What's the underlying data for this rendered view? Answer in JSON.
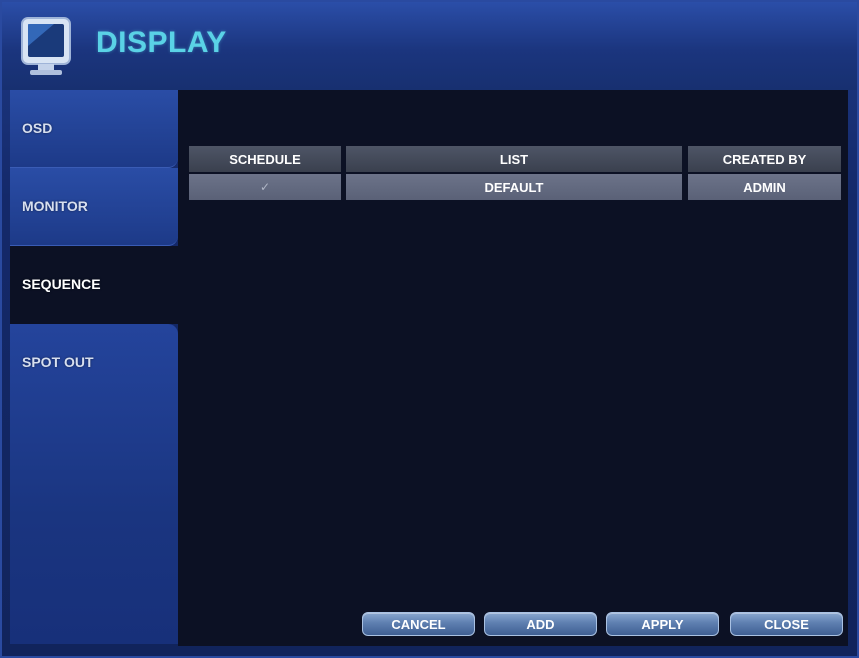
{
  "header": {
    "title": "DISPLAY",
    "icon": "monitor-icon"
  },
  "sidebar": {
    "items": [
      {
        "label": "OSD",
        "active": false
      },
      {
        "label": "MONITOR",
        "active": false
      },
      {
        "label": "SEQUENCE",
        "active": true
      },
      {
        "label": "SPOT OUT",
        "active": false
      }
    ]
  },
  "table": {
    "columns": [
      "SCHEDULE",
      "LIST",
      "CREATED BY"
    ],
    "rows": [
      {
        "schedule": "✓",
        "list": "DEFAULT",
        "created_by": "ADMIN"
      }
    ]
  },
  "buttons": {
    "cancel": "CANCEL",
    "add": "ADD",
    "apply": "APPLY",
    "close": "CLOSE"
  },
  "colors": {
    "title": "#5ad2e6",
    "content_bg": "#0c1124",
    "sidebar_bg": "#1d3a88"
  }
}
